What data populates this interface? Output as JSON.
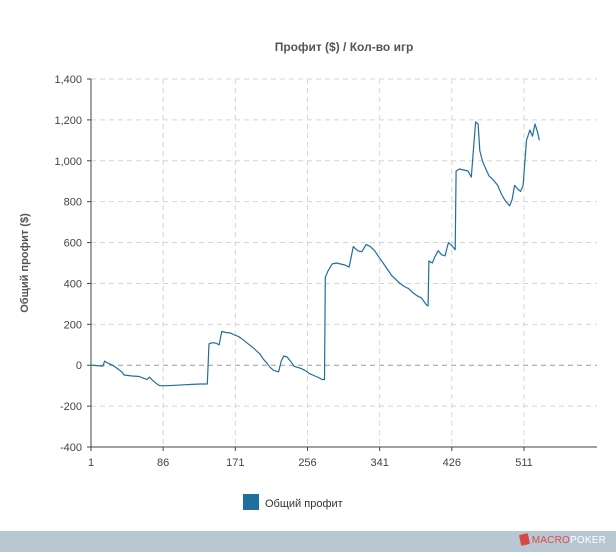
{
  "chart_data": {
    "type": "line",
    "title": "Профит ($) / Кол-во игр",
    "ylabel": "Общий профит ($)",
    "xlabel": "",
    "x_ticks": [
      "1",
      "86",
      "171",
      "256",
      "341",
      "426",
      "511"
    ],
    "y_ticks": [
      "1,400",
      "1,200",
      "1,000",
      "800",
      "600",
      "400",
      "200",
      "0",
      "-200",
      "-400"
    ],
    "xlim": [
      1,
      597
    ],
    "ylim": [
      -400,
      1400
    ],
    "grid": true,
    "legend_position": "bottom",
    "series": [
      {
        "name": "Общий профит",
        "color": "#1f6f9c",
        "points": [
          [
            1,
            0
          ],
          [
            8,
            -2
          ],
          [
            15,
            -5
          ],
          [
            17,
            20
          ],
          [
            20,
            12
          ],
          [
            25,
            3
          ],
          [
            30,
            -10
          ],
          [
            34,
            -22
          ],
          [
            38,
            -35
          ],
          [
            40,
            -48
          ],
          [
            48,
            -52
          ],
          [
            58,
            -55
          ],
          [
            62,
            -62
          ],
          [
            67,
            -70
          ],
          [
            70,
            -58
          ],
          [
            73,
            -72
          ],
          [
            78,
            -90
          ],
          [
            82,
            -100
          ],
          [
            90,
            -100
          ],
          [
            100,
            -98
          ],
          [
            110,
            -96
          ],
          [
            120,
            -94
          ],
          [
            130,
            -92
          ],
          [
            138,
            -92
          ],
          [
            140,
            105
          ],
          [
            144,
            110
          ],
          [
            148,
            108
          ],
          [
            152,
            100
          ],
          [
            155,
            165
          ],
          [
            160,
            160
          ],
          [
            165,
            158
          ],
          [
            170,
            148
          ],
          [
            175,
            140
          ],
          [
            180,
            125
          ],
          [
            186,
            105
          ],
          [
            192,
            85
          ],
          [
            196,
            70
          ],
          [
            200,
            55
          ],
          [
            204,
            30
          ],
          [
            208,
            12
          ],
          [
            212,
            -10
          ],
          [
            216,
            -25
          ],
          [
            220,
            -30
          ],
          [
            222,
            -32
          ],
          [
            225,
            20
          ],
          [
            228,
            45
          ],
          [
            232,
            40
          ],
          [
            236,
            20
          ],
          [
            240,
            -5
          ],
          [
            244,
            -10
          ],
          [
            248,
            -15
          ],
          [
            253,
            -25
          ],
          [
            258,
            -40
          ],
          [
            262,
            -48
          ],
          [
            266,
            -55
          ],
          [
            270,
            -62
          ],
          [
            273,
            -70
          ],
          [
            276,
            -70
          ],
          [
            277,
            430
          ],
          [
            280,
            460
          ],
          [
            285,
            495
          ],
          [
            290,
            500
          ],
          [
            295,
            495
          ],
          [
            300,
            490
          ],
          [
            305,
            480
          ],
          [
            310,
            580
          ],
          [
            315,
            560
          ],
          [
            320,
            555
          ],
          [
            325,
            590
          ],
          [
            330,
            580
          ],
          [
            335,
            560
          ],
          [
            340,
            530
          ],
          [
            345,
            500
          ],
          [
            350,
            470
          ],
          [
            355,
            440
          ],
          [
            360,
            420
          ],
          [
            365,
            400
          ],
          [
            370,
            385
          ],
          [
            375,
            375
          ],
          [
            380,
            355
          ],
          [
            385,
            340
          ],
          [
            390,
            330
          ],
          [
            396,
            295
          ],
          [
            398,
            290
          ],
          [
            399,
            510
          ],
          [
            403,
            500
          ],
          [
            406,
            530
          ],
          [
            410,
            560
          ],
          [
            414,
            540
          ],
          [
            418,
            535
          ],
          [
            422,
            600
          ],
          [
            426,
            585
          ],
          [
            430,
            565
          ],
          [
            431,
            950
          ],
          [
            435,
            960
          ],
          [
            440,
            955
          ],
          [
            445,
            950
          ],
          [
            449,
            920
          ],
          [
            454,
            1190
          ],
          [
            457,
            1180
          ],
          [
            459,
            1050
          ],
          [
            462,
            1000
          ],
          [
            466,
            960
          ],
          [
            470,
            925
          ],
          [
            474,
            910
          ],
          [
            480,
            880
          ],
          [
            484,
            840
          ],
          [
            488,
            810
          ],
          [
            491,
            795
          ],
          [
            494,
            780
          ],
          [
            497,
            810
          ],
          [
            500,
            880
          ],
          [
            504,
            860
          ],
          [
            507,
            850
          ],
          [
            510,
            880
          ],
          [
            514,
            1100
          ],
          [
            518,
            1150
          ],
          [
            521,
            1120
          ],
          [
            524,
            1180
          ],
          [
            527,
            1140
          ],
          [
            529,
            1100
          ]
        ]
      }
    ]
  },
  "brand": {
    "macro": "MACRO",
    "poker": "POKER"
  }
}
